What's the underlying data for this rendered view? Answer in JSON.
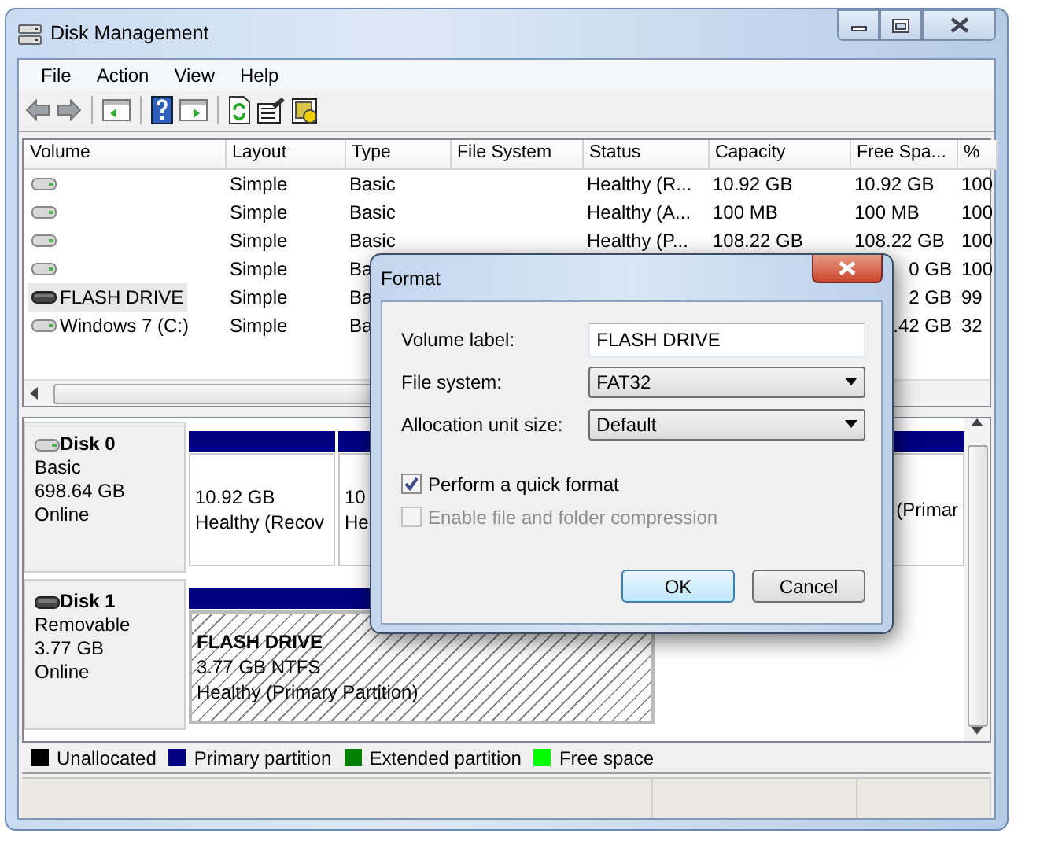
{
  "window": {
    "title": "Disk Management"
  },
  "menu": [
    "File",
    "Action",
    "View",
    "Help"
  ],
  "volumes": {
    "columns": [
      "Volume",
      "Layout",
      "Type",
      "File System",
      "Status",
      "Capacity",
      "Free Spa...",
      "%"
    ],
    "rows": [
      {
        "kind": "fixed",
        "selected": false,
        "cells": [
          "",
          "Simple",
          "Basic",
          "",
          "Healthy (R...",
          "10.92 GB",
          "10.92 GB",
          "100"
        ]
      },
      {
        "kind": "fixed",
        "selected": false,
        "cells": [
          "",
          "Simple",
          "Basic",
          "",
          "Healthy (A...",
          "100 MB",
          "100 MB",
          "100"
        ]
      },
      {
        "kind": "fixed",
        "selected": false,
        "cells": [
          "",
          "Simple",
          "Basic",
          "",
          "Healthy (P...",
          "108.22 GB",
          "108.22 GB",
          "100"
        ]
      },
      {
        "kind": "fixed",
        "selected": false,
        "covered": true,
        "cells": [
          "",
          "Simple",
          "Ba",
          "",
          "",
          "",
          "0 GB",
          "100"
        ]
      },
      {
        "kind": "removable",
        "selected": true,
        "covered": true,
        "cells": [
          "FLASH DRIVE",
          "Simple",
          "Ba",
          "",
          "",
          "",
          "2 GB",
          "99"
        ]
      },
      {
        "kind": "fixed",
        "selected": false,
        "covered": true,
        "cells": [
          "Windows 7 (C:)",
          "Simple",
          "Ba",
          "",
          "",
          "",
          ".42 GB",
          "32"
        ]
      }
    ]
  },
  "disks": [
    {
      "name": "Disk 0",
      "kind": "fixed",
      "type": "Basic",
      "size": "698.64 GB",
      "state": "Online",
      "partitions": [
        {
          "selected": false,
          "lines": [
            "10.92 GB",
            "Healthy (Recov"
          ]
        },
        {
          "selected": false,
          "lines": [
            "10",
            "He"
          ]
        },
        {
          "selected": false,
          "lines": [
            "(Primar"
          ]
        }
      ]
    },
    {
      "name": "Disk 1",
      "kind": "removable",
      "type": "Removable",
      "size": "3.77 GB",
      "state": "Online",
      "partitions": [
        {
          "selected": true,
          "title": "FLASH DRIVE",
          "lines": [
            "3.77 GB NTFS",
            "Healthy (Primary Partition)"
          ]
        }
      ]
    }
  ],
  "legend": [
    {
      "label": "Unallocated",
      "color": "#000000"
    },
    {
      "label": "Primary partition",
      "color": "#000080"
    },
    {
      "label": "Extended partition",
      "color": "#008000"
    },
    {
      "label": "Free space",
      "color": "#00ff00"
    }
  ],
  "dialog": {
    "title": "Format",
    "fields": [
      {
        "kind": "text",
        "label": "Volume label:",
        "value": "FLASH DRIVE"
      },
      {
        "kind": "select",
        "label": "File system:",
        "value": "FAT32"
      },
      {
        "kind": "select",
        "label": "Allocation unit size:",
        "value": "Default"
      }
    ],
    "options": [
      {
        "label": "Perform a quick format",
        "checked": true,
        "disabled": false
      },
      {
        "label": "Enable file and folder compression",
        "checked": false,
        "disabled": true
      }
    ],
    "buttons": [
      {
        "label": "OK",
        "default": true
      },
      {
        "label": "Cancel",
        "default": false
      }
    ]
  }
}
